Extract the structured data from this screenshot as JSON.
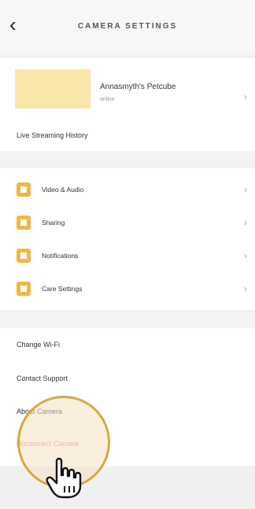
{
  "header": {
    "title": "CAMERA SETTINGS",
    "back_icon": "chevron-left-icon"
  },
  "camera": {
    "name": "Annasmyth's Petcube",
    "status": "online",
    "thumbnail_color": "#f8e7a8"
  },
  "section1": {
    "live_streaming_history": "Live Streaming History"
  },
  "section2": {
    "items": [
      {
        "label": "Video & Audio",
        "icon": "video-icon"
      },
      {
        "label": "Sharing",
        "icon": "sharing-icon"
      },
      {
        "label": "Notifications",
        "icon": "notifications-icon"
      },
      {
        "label": "Care Settings",
        "icon": "care-icon"
      }
    ],
    "accent": "#f2b73f"
  },
  "section3": {
    "change_wifi": "Change Wi-Fi",
    "contact_support": "Contact Support",
    "about_camera": "About Camera",
    "disconnect_camera": "Disconnect Camera"
  },
  "overlay": {
    "pointer_icon": "hand-pointer-icon",
    "ring_color": "#d8a842"
  }
}
